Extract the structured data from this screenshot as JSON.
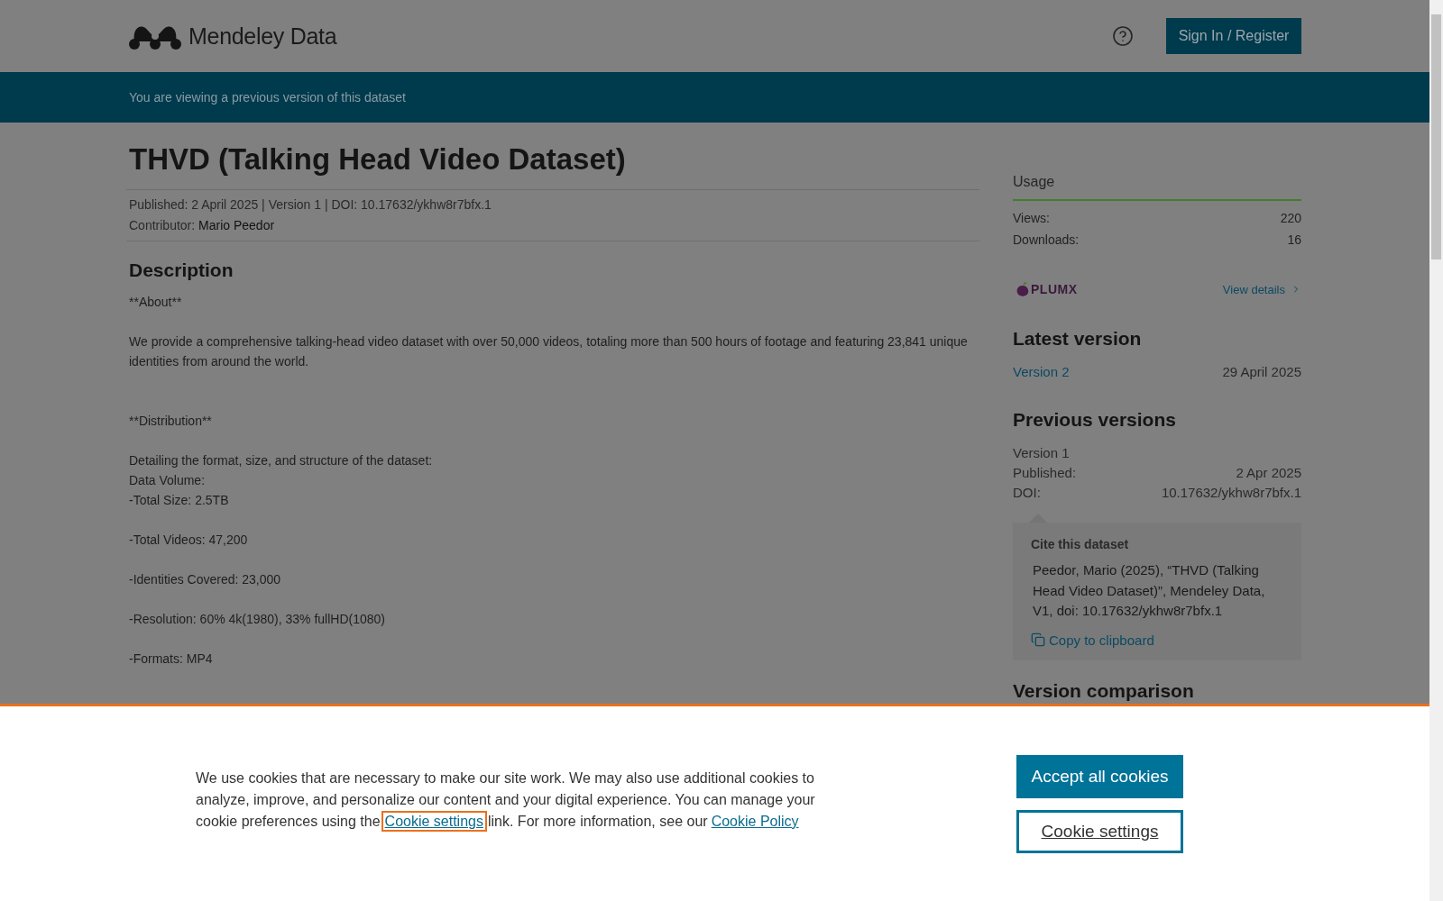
{
  "header": {
    "logo_text": "Mendeley Data",
    "sign_in": "Sign In / Register"
  },
  "notice": "You are viewing a previous version of this dataset",
  "dataset": {
    "title": "THVD (Talking Head Video Dataset)",
    "meta": "Published: 2 April 2025 | Version 1 | DOI: 10.17632/ykhw8r7bfx.1",
    "contributor_label": "Contributor:",
    "contributor": "Mario Peedor"
  },
  "description": {
    "heading": "Description",
    "blocks": [
      {
        "kind": "section",
        "lines": [
          "**About**"
        ]
      },
      {
        "kind": "para",
        "lines": [
          "We provide a comprehensive talking-head video dataset with over 50,000 videos, totaling more than 500 hours of footage and featuring 23,841 unique identities from around the world."
        ]
      },
      {
        "kind": "section",
        "lines": [
          "**Distribution**"
        ]
      },
      {
        "kind": "para",
        "lines": [
          "Detailing the format, size, and structure of the dataset:",
          "Data Volume:",
          "-Total Size: 2.5TB"
        ]
      },
      {
        "kind": "para",
        "lines": [
          "-Total Videos: 47,200"
        ]
      },
      {
        "kind": "para",
        "lines": [
          "-Identities Covered: 23,000"
        ]
      },
      {
        "kind": "para",
        "lines": [
          "-Resolution: 60% 4k(1980), 33% fullHD(1080)"
        ]
      },
      {
        "kind": "para",
        "lines": [
          "-Formats: MP4"
        ]
      }
    ]
  },
  "usage": {
    "heading": "Usage",
    "stats": [
      {
        "label": "Views:",
        "value": "220"
      },
      {
        "label": "Downloads:",
        "value": "16"
      }
    ],
    "plumx_logo": "PLUMX",
    "view_details": "View details"
  },
  "latest_version": {
    "heading": "Latest version",
    "link": "Version 2",
    "date": "29 April 2025"
  },
  "previous_versions": {
    "heading": "Previous versions",
    "version": "Version 1",
    "rows": [
      {
        "label": "Published:",
        "value": "2 Apr 2025"
      },
      {
        "label": "DOI:",
        "value": "10.17632/ykhw8r7bfx.1"
      }
    ]
  },
  "cite": {
    "heading": "Cite this dataset",
    "text": "Peedor, Mario (2025), “THVD (Talking Head Video Dataset)”, Mendeley Data, V1, doi: 10.17632/ykhw8r7bfx.1",
    "copy": "Copy to clipboard"
  },
  "version_comparison": {
    "heading": "Version comparison"
  },
  "cookie_banner": {
    "text_before": "We use cookies that are necessary to make our site work. We may also use additional cookies to analyze, improve, and personalize our content and your digital experience. You can manage your cookie preferences using the",
    "settings_link": "Cookie settings",
    "text_middle": "link. For more information, see our",
    "policy_link": "Cookie Policy",
    "accept": "Accept all cookies",
    "settings_button": "Cookie settings"
  }
}
